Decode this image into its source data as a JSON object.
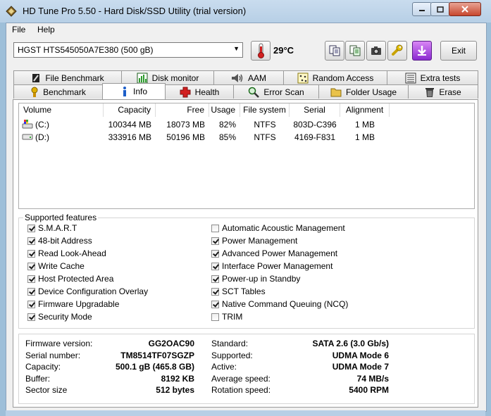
{
  "window": {
    "title": "HD Tune Pro 5.50 - Hard Disk/SSD Utility (trial version)"
  },
  "menu": {
    "file": "File",
    "help": "Help"
  },
  "toolbar": {
    "drive": "HGST HTS545050A7E380 (500 gB)",
    "temperature": "29°C",
    "exit_label": "Exit"
  },
  "tabs_top": [
    "File Benchmark",
    "Disk monitor",
    "AAM",
    "Random Access",
    "Extra tests"
  ],
  "tabs_bottom": [
    "Benchmark",
    "Info",
    "Health",
    "Error Scan",
    "Folder Usage",
    "Erase"
  ],
  "active_tab": "Info",
  "volumes": {
    "headers": [
      "Volume",
      "Capacity",
      "Free",
      "Usage",
      "File system",
      "Serial",
      "Alignment"
    ],
    "rows": [
      [
        "(C:)",
        "100344 MB",
        "18073 MB",
        "82%",
        "NTFS",
        "803D-C396",
        "1 MB"
      ],
      [
        "(D:)",
        "333916 MB",
        "50196 MB",
        "85%",
        "NTFS",
        "4169-F831",
        "1 MB"
      ]
    ]
  },
  "features": {
    "title": "Supported features",
    "left": [
      {
        "label": "S.M.A.R.T",
        "checked": true
      },
      {
        "label": "48-bit Address",
        "checked": true
      },
      {
        "label": "Read Look-Ahead",
        "checked": true
      },
      {
        "label": "Write Cache",
        "checked": true
      },
      {
        "label": "Host Protected Area",
        "checked": true
      },
      {
        "label": "Device Configuration Overlay",
        "checked": true
      },
      {
        "label": "Firmware Upgradable",
        "checked": true
      },
      {
        "label": "Security Mode",
        "checked": true
      }
    ],
    "right": [
      {
        "label": "Automatic Acoustic Management",
        "checked": false
      },
      {
        "label": "Power Management",
        "checked": true
      },
      {
        "label": "Advanced Power Management",
        "checked": true
      },
      {
        "label": "Interface Power Management",
        "checked": true
      },
      {
        "label": "Power-up in Standby",
        "checked": true
      },
      {
        "label": "SCT Tables",
        "checked": true
      },
      {
        "label": "Native Command Queuing (NCQ)",
        "checked": true
      },
      {
        "label": "TRIM",
        "checked": false
      }
    ]
  },
  "info": {
    "left": [
      {
        "label": "Firmware version:",
        "value": "GG2OAC90"
      },
      {
        "label": "Serial number:",
        "value": "TM8514TF07SGZP"
      },
      {
        "label": "Capacity:",
        "value": "500.1 gB (465.8 GB)"
      },
      {
        "label": "Buffer:",
        "value": "8192 KB"
      },
      {
        "label": "Sector size",
        "value": "512 bytes"
      }
    ],
    "right": [
      {
        "label": "Standard:",
        "value": "SATA 2.6 (3.0 Gb/s)"
      },
      {
        "label": "Supported:",
        "value": "UDMA Mode 6"
      },
      {
        "label": "Active:",
        "value": "UDMA Mode 7"
      },
      {
        "label": "Average speed:",
        "value": "74 MB/s"
      },
      {
        "label": "Rotation speed:",
        "value": "5400 RPM"
      }
    ]
  }
}
